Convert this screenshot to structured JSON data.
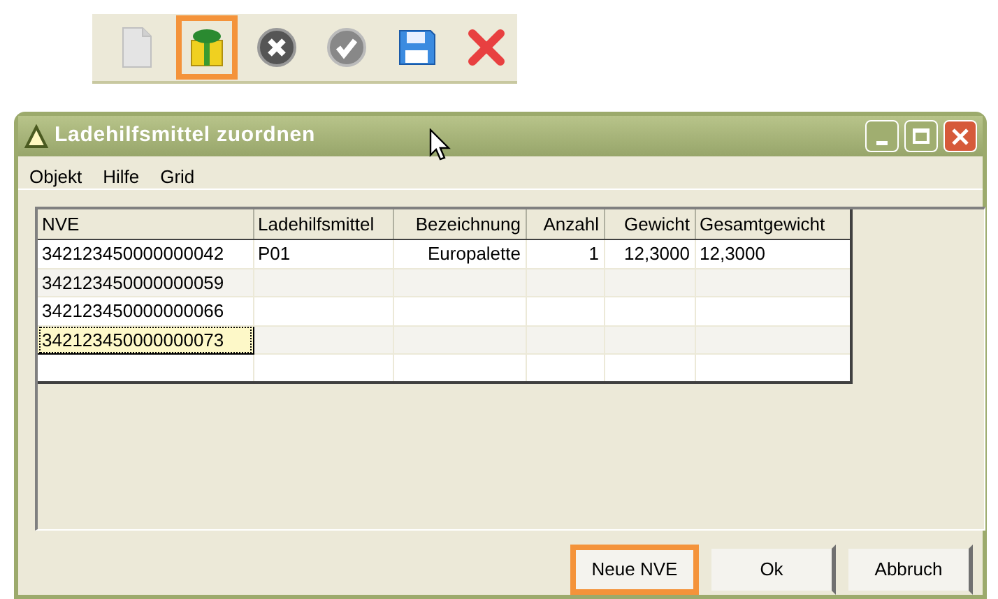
{
  "toolbar": [
    {
      "kind": "document",
      "highlighted": false
    },
    {
      "kind": "gift",
      "highlighted": true
    },
    {
      "kind": "cancel",
      "highlighted": false
    },
    {
      "kind": "check",
      "highlighted": false
    },
    {
      "kind": "save",
      "highlighted": false
    },
    {
      "kind": "delete",
      "highlighted": false
    }
  ],
  "window": {
    "title": "Ladehilfsmittel zuordnen"
  },
  "menu": [
    "Objekt",
    "Hilfe",
    "Grid"
  ],
  "table": {
    "columns": [
      "NVE",
      "Ladehilfsmittel",
      "Bezeichnung",
      "Anzahl",
      "Gewicht",
      "Gesamtgewicht"
    ],
    "rows": [
      {
        "cells": [
          "342123450000000042",
          "P01",
          "Europalette",
          "1",
          "12,3000",
          "12,3000"
        ],
        "focused": false
      },
      {
        "cells": [
          "342123450000000059"
        ],
        "focused": false
      },
      {
        "cells": [
          "342123450000000066"
        ],
        "focused": false
      },
      {
        "cells": [
          "342123450000000073"
        ],
        "focused": true
      },
      {
        "cells": [],
        "focused": false
      }
    ]
  },
  "buttons": [
    {
      "label": "Neue NVE",
      "highlighted": true
    },
    {
      "label": "Ok",
      "highlighted": false
    },
    {
      "label": "Abbruch",
      "highlighted": false
    }
  ]
}
